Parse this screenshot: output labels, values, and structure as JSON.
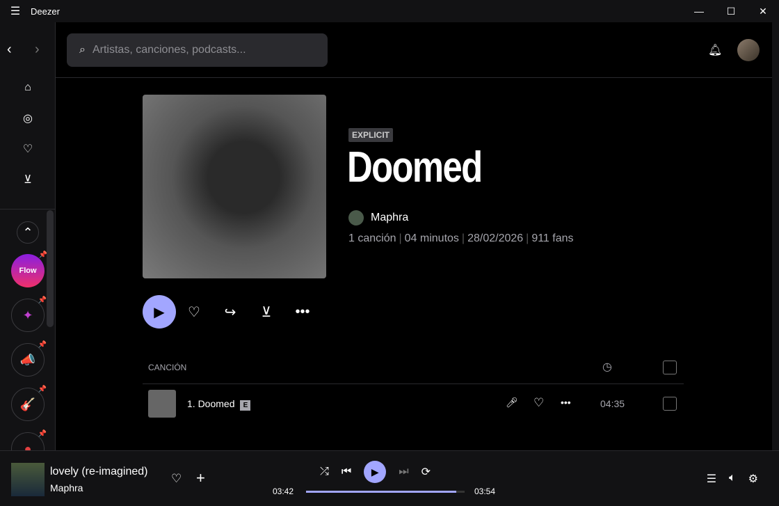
{
  "app": {
    "title": "Deezer"
  },
  "search": {
    "placeholder": "Artistas, canciones, podcasts..."
  },
  "album": {
    "badge": "EXPLICIT",
    "title": "Doomed",
    "artist": "Maphra",
    "tracks_count": "1 canción",
    "duration": "04 minutos",
    "date": "28/02/2026",
    "fans": "911 fans"
  },
  "sidebar": {
    "flow_label": "Flow"
  },
  "table": {
    "header_song": "CANCIÓN",
    "rows": [
      {
        "title": "1. Doomed",
        "explicit": "E",
        "duration": "04:35"
      }
    ]
  },
  "player": {
    "title": "lovely (re-imagined)",
    "artist": "Maphra",
    "elapsed": "03:42",
    "total": "03:54",
    "progress": 0.949
  },
  "colors": {
    "accent": "#a2a6ff"
  }
}
